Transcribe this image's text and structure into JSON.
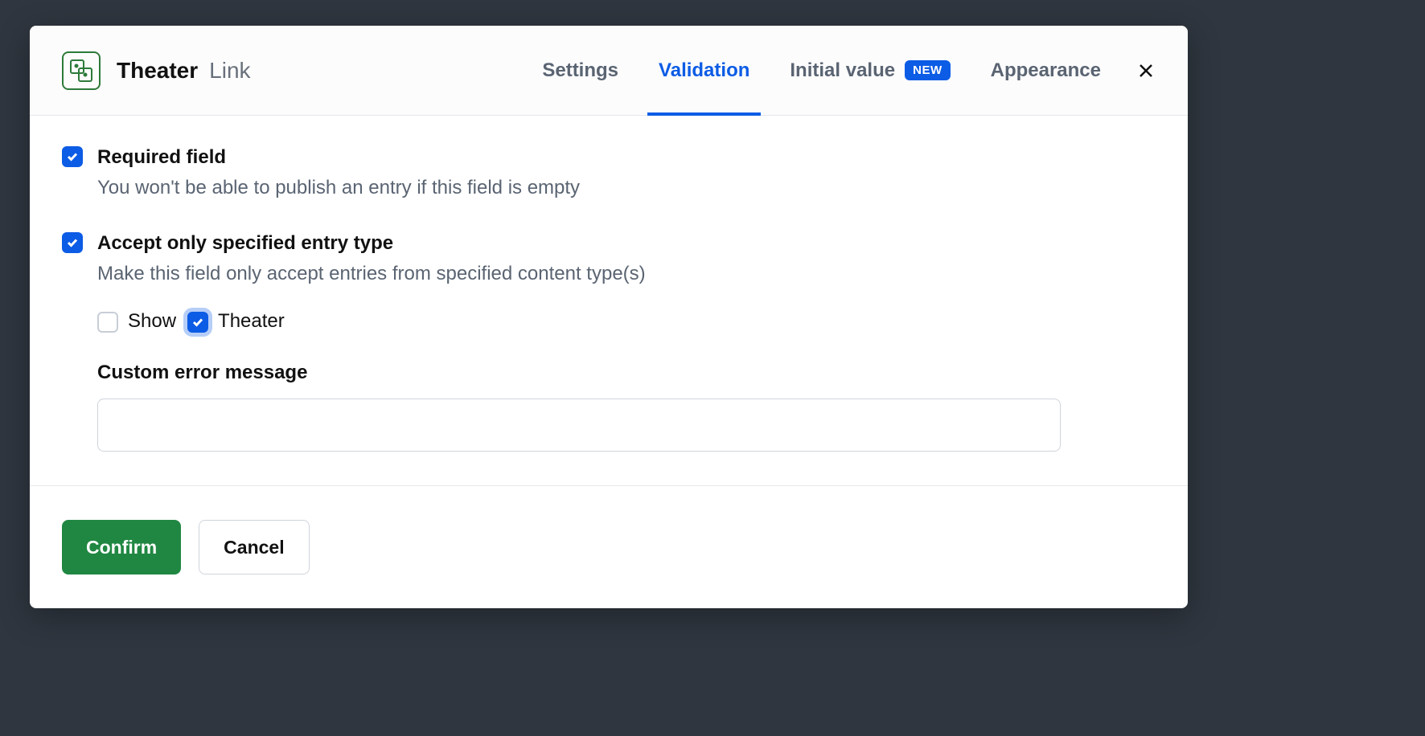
{
  "header": {
    "field_name": "Theater",
    "field_type": "Link",
    "tabs": [
      {
        "label": "Settings",
        "active": false
      },
      {
        "label": "Validation",
        "active": true
      },
      {
        "label": "Initial value",
        "active": false,
        "badge": "NEW"
      },
      {
        "label": "Appearance",
        "active": false
      }
    ]
  },
  "validations": {
    "required": {
      "label": "Required field",
      "description": "You won't be able to publish an entry if this field is empty",
      "checked": true
    },
    "accept_only": {
      "label": "Accept only specified entry type",
      "description": "Make this field only accept entries from specified content type(s)",
      "checked": true,
      "entry_types": [
        {
          "label": "Show",
          "checked": false
        },
        {
          "label": "Theater",
          "checked": true,
          "focused": true
        }
      ],
      "custom_error_label": "Custom error message",
      "custom_error_value": ""
    }
  },
  "footer": {
    "confirm_label": "Confirm",
    "cancel_label": "Cancel"
  }
}
